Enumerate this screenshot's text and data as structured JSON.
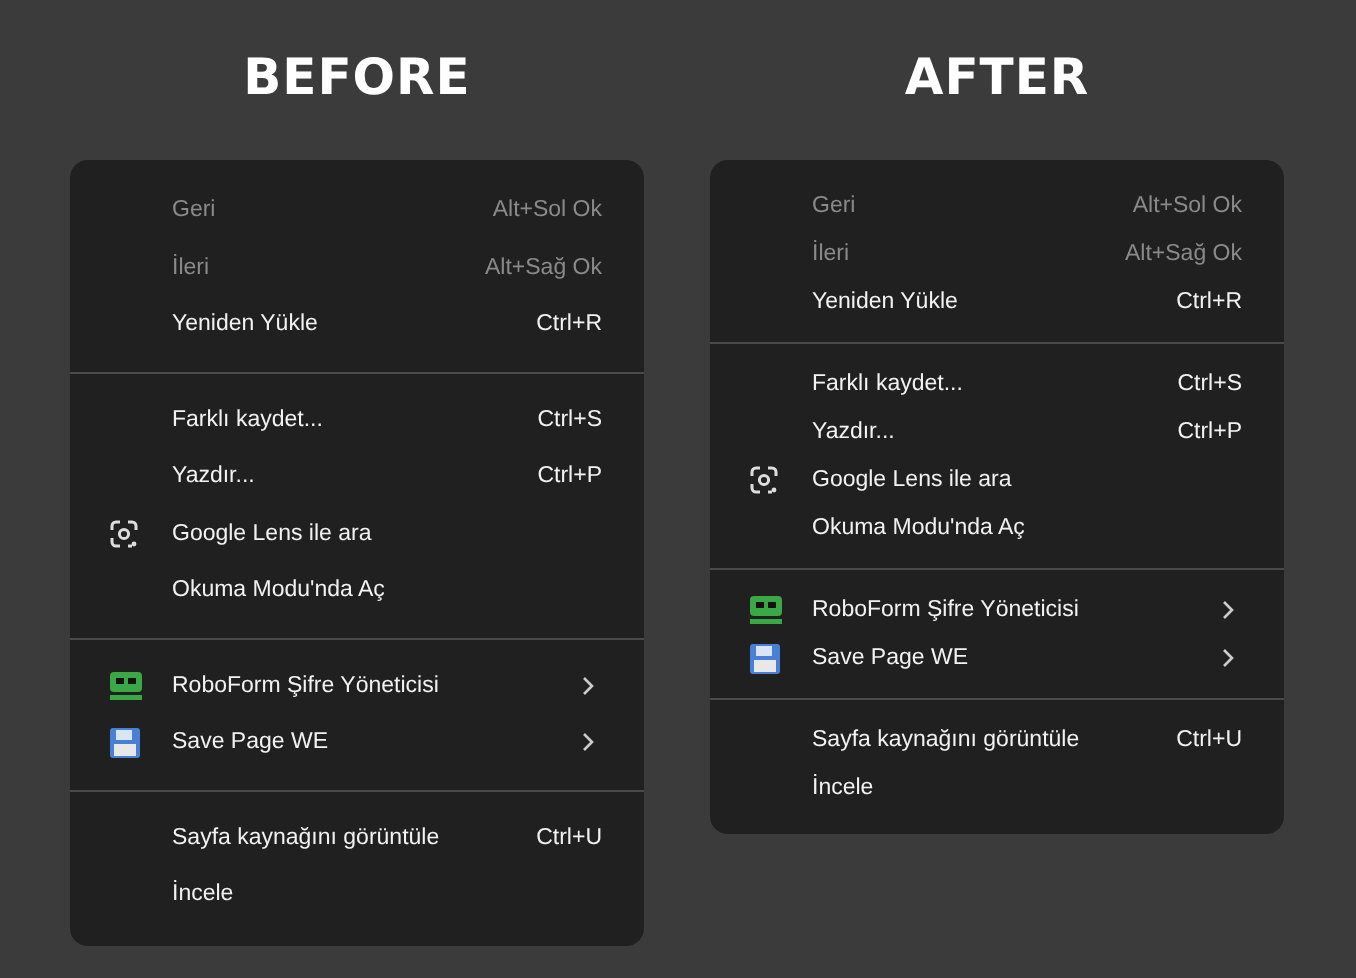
{
  "panels": [
    {
      "title": "BEFORE",
      "kind": "roomy",
      "groups": [
        [
          {
            "label": "Geri",
            "shortcut": "Alt+Sol Ok",
            "disabled": true
          },
          {
            "label": "İleri",
            "shortcut": "Alt+Sağ Ok",
            "disabled": true
          },
          {
            "label": "Yeniden Yükle",
            "shortcut": "Ctrl+R",
            "disabled": false
          }
        ],
        [
          {
            "label": "Farklı kaydet...",
            "shortcut": "Ctrl+S",
            "disabled": false
          },
          {
            "label": "Yazdır...",
            "shortcut": "Ctrl+P",
            "disabled": false
          },
          {
            "label": "Google Lens ile ara",
            "kind": "lens",
            "disabled": false
          },
          {
            "label": "Okuma Modu'nda Aç",
            "disabled": false
          }
        ],
        [
          {
            "label": "RoboForm Şifre Yöneticisi",
            "kind": "robot",
            "submenu": true,
            "disabled": false
          },
          {
            "label": "Save Page WE",
            "kind": "floppy",
            "submenu": true,
            "disabled": false
          }
        ],
        [
          {
            "label": "Sayfa kaynağını görüntüle",
            "shortcut": "Ctrl+U",
            "disabled": false
          },
          {
            "label": "İncele",
            "disabled": false
          }
        ]
      ]
    },
    {
      "title": "AFTER",
      "kind": "compact",
      "groups": [
        [
          {
            "label": "Geri",
            "shortcut": "Alt+Sol Ok",
            "disabled": true
          },
          {
            "label": "İleri",
            "shortcut": "Alt+Sağ Ok",
            "disabled": true
          },
          {
            "label": "Yeniden Yükle",
            "shortcut": "Ctrl+R",
            "disabled": false
          }
        ],
        [
          {
            "label": "Farklı kaydet...",
            "shortcut": "Ctrl+S",
            "disabled": false
          },
          {
            "label": "Yazdır...",
            "shortcut": "Ctrl+P",
            "disabled": false
          },
          {
            "label": "Google Lens ile ara",
            "kind": "lens",
            "disabled": false
          },
          {
            "label": "Okuma Modu'nda Aç",
            "disabled": false
          }
        ],
        [
          {
            "label": "RoboForm Şifre Yöneticisi",
            "kind": "robot",
            "submenu": true,
            "disabled": false
          },
          {
            "label": "Save Page WE",
            "kind": "floppy",
            "submenu": true,
            "disabled": false
          }
        ],
        [
          {
            "label": "Sayfa kaynağını görüntüle",
            "shortcut": "Ctrl+U",
            "disabled": false
          },
          {
            "label": "İncele",
            "disabled": false
          }
        ]
      ]
    }
  ]
}
